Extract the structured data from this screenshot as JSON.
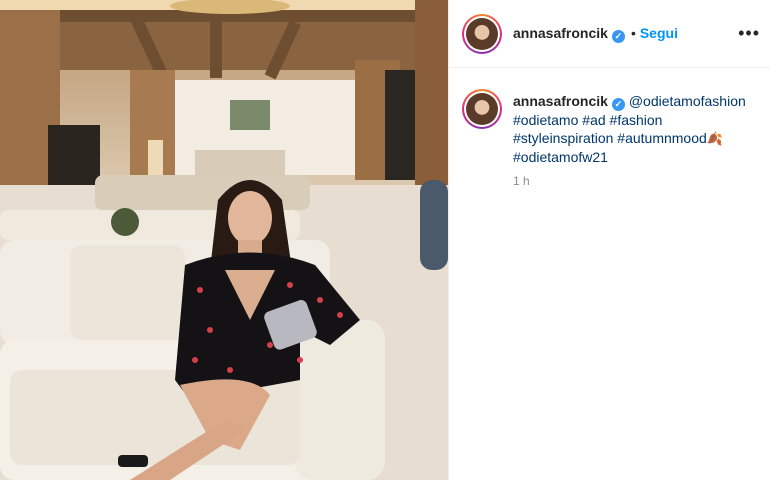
{
  "post": {
    "username": "annasafroncik",
    "follow_separator": "•",
    "follow_label": "Segui",
    "caption": {
      "mention": "@odietamofashion",
      "hashtags": [
        "#odietamo",
        "#ad",
        "#fashion",
        "#styleinspiration",
        "#autumnmood",
        "#odietamofw21"
      ]
    },
    "timestamp": "1 h"
  },
  "icons": {
    "verified": "verified-badge-icon",
    "more": "more-options-icon",
    "leaf": "autumn-leaf-emoji"
  },
  "colors": {
    "link": "#00376b",
    "follow": "#0095f6",
    "verified": "#3897f0",
    "muted": "#8e8e8e"
  }
}
